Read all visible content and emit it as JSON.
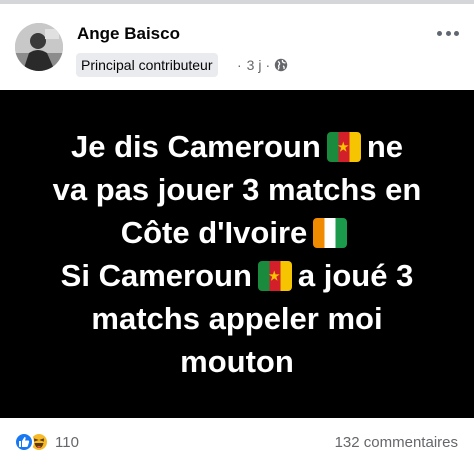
{
  "post": {
    "author": "Ange Baisco",
    "badge": "Principal contributeur",
    "time": "3 j",
    "separator": "·",
    "audience_icon": "globe-icon",
    "more_icon": "more-horizontal-icon"
  },
  "content": {
    "background_color": "#000000",
    "text_color": "#ffffff",
    "lines": [
      {
        "before": "Je dis Cameroun",
        "flag": "cameroon-flag",
        "after": "ne"
      },
      {
        "text": "va pas jouer 3 matchs en"
      },
      {
        "before": "Côte d'Ivoire",
        "flag": "ivory-coast-flag",
        "after": ""
      },
      {
        "before": "Si Cameroun",
        "flag": "cameroon-flag",
        "after": "a joué 3"
      },
      {
        "text": "matchs appeler moi"
      },
      {
        "text": "mouton"
      }
    ]
  },
  "footer": {
    "reactions": [
      "like-icon",
      "haha-icon"
    ],
    "reaction_count": "110",
    "comments": "132 commentaires"
  },
  "colors": {
    "like_blue": "#1877f2",
    "haha_yellow": "#f7b928",
    "secondary_text": "#65676b"
  }
}
